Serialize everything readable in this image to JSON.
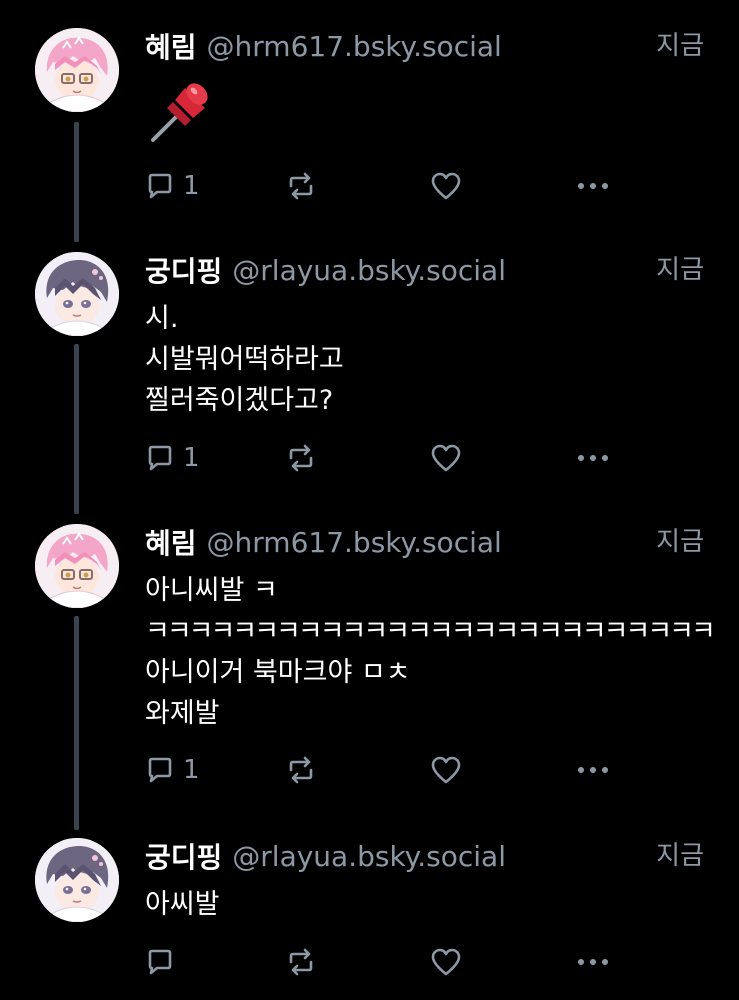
{
  "colors": {
    "background": "#000000",
    "text_primary": "#ffffff",
    "text_secondary": "#8d98a5",
    "thread_line": "#38434f",
    "pin_red": "#d62839"
  },
  "posts": [
    {
      "display_name": "혜림",
      "handle": "@hrm617.bsky.social",
      "timestamp": "지금",
      "avatar_icon": "pink-hair-character-avatar",
      "body_emoji": "pushpin",
      "lines": [],
      "reply_count": "1"
    },
    {
      "display_name": "궁디핑",
      "handle": "@rlayua.bsky.social",
      "timestamp": "지금",
      "avatar_icon": "purple-hair-character-avatar",
      "lines": [
        "시.",
        "시발뭐어떡하라고",
        "찔러죽이겠다고?"
      ],
      "reply_count": "1"
    },
    {
      "display_name": "혜림",
      "handle": "@hrm617.bsky.social",
      "timestamp": "지금",
      "avatar_icon": "pink-hair-character-avatar",
      "lines": [
        "아니씨발 ㅋ",
        "ㅋㅋㅋㅋㅋㅋㅋㅋㅋㅋㅋㅋㅋㅋㅋㅋㅋㅋㅋㅋㅋㅋㅋㅋㅋㅋ",
        "아니이거 북마크야 ㅁㅊ",
        "와제발"
      ],
      "reply_count": "1"
    },
    {
      "display_name": "궁디핑",
      "handle": "@rlayua.bsky.social",
      "timestamp": "지금",
      "avatar_icon": "purple-hair-character-avatar",
      "lines": [
        "아씨발"
      ],
      "reply_count": ""
    }
  ],
  "icons": {
    "reply": "reply-bubble-icon",
    "repost": "repost-arrows-icon",
    "like": "heart-icon",
    "more": "more-dots-icon"
  }
}
